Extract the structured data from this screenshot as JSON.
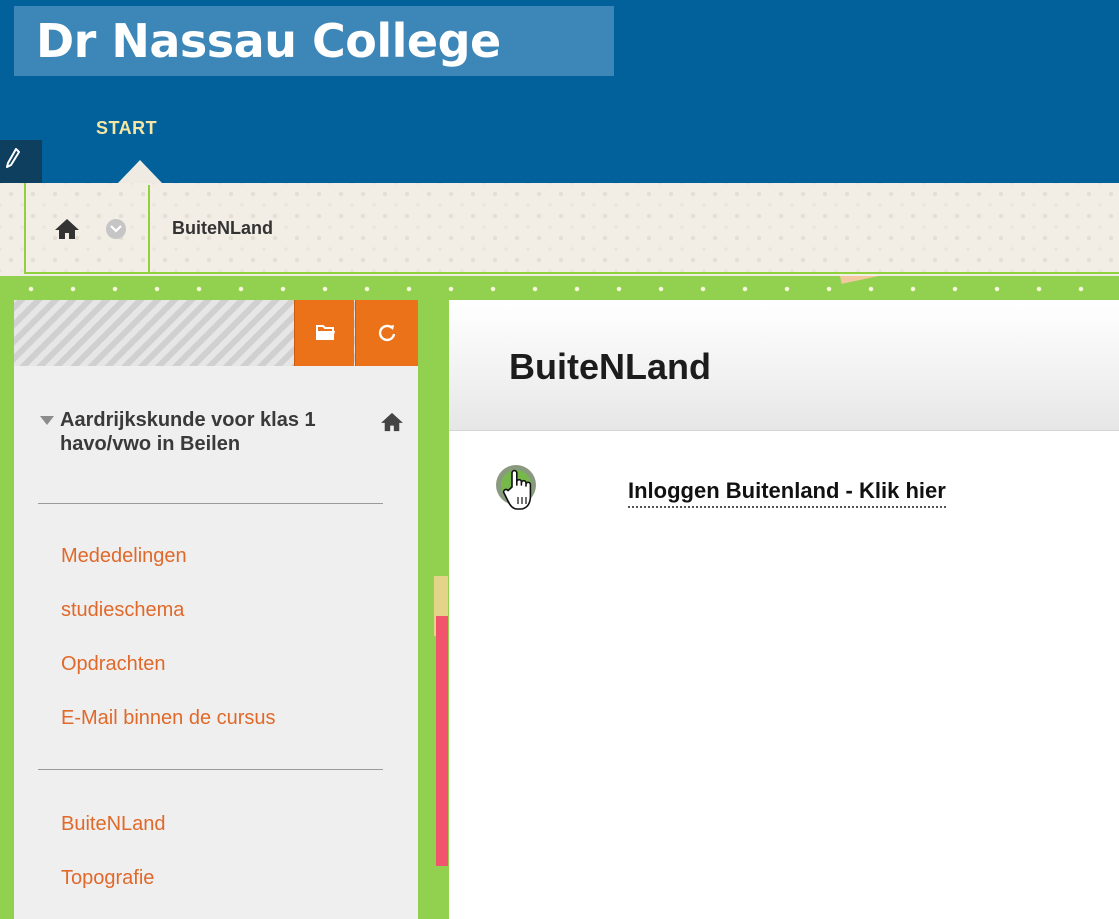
{
  "header": {
    "logo_text": "Dr Nassau College",
    "nav_start": "START"
  },
  "breadcrumb": {
    "current": "BuiteNLand"
  },
  "sidebar": {
    "course_title": "Aardrijkskunde voor klas 1 havo/vwo in Beilen",
    "group1": [
      "Mededelingen",
      "studieschema",
      "Opdrachten",
      "E-Mail binnen de cursus"
    ],
    "group2": [
      "BuiteNLand",
      "Topografie"
    ]
  },
  "content": {
    "page_title": "BuiteNLand",
    "item_link": "Inloggen Buitenland - Klik hier"
  },
  "icons": {
    "edit": "edit-pencil-icon",
    "home": "home-icon",
    "chevron": "chevron-down-icon",
    "folder": "folder-icon",
    "refresh": "refresh-icon",
    "course_home": "course-home-icon",
    "item": "web-link-icon"
  },
  "colors": {
    "header_blue": "#02619a",
    "logo_box": "#3d86b8",
    "nav_text": "#f5e7a3",
    "accent_green": "#8fd23d",
    "accent_orange": "#ec7219",
    "link_orange": "#e0692a"
  }
}
